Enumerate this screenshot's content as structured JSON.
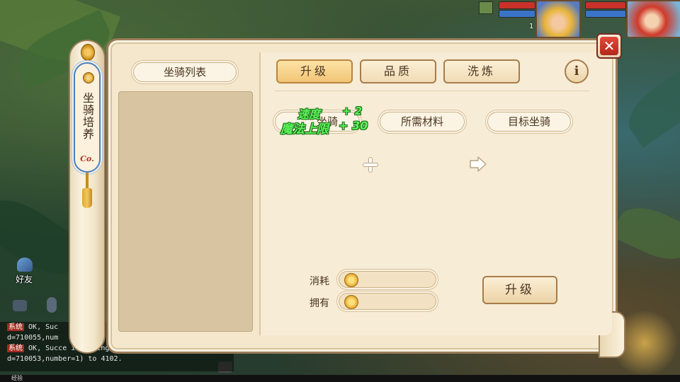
{
  "side_tab": {
    "label": "坐骑培养",
    "logo": "Co."
  },
  "mount_list": {
    "title": "坐骑列表"
  },
  "tabs": [
    {
      "label": "升级",
      "active": true
    },
    {
      "label": "品质",
      "active": false
    },
    {
      "label": "洗炼",
      "active": false
    }
  ],
  "info_label": "i",
  "sections": {
    "current_mount": "坐骑",
    "materials": "所需材料",
    "target_mount": "目标坐骑"
  },
  "floating_stats": [
    {
      "name": "速度",
      "value": "+ 2"
    },
    {
      "name": "魔法上限",
      "value": "+ 30"
    }
  ],
  "cost": {
    "label": "消耗",
    "value": ""
  },
  "owned": {
    "label": "拥有",
    "value": ""
  },
  "upgrade_button": "升级",
  "close_label": "✕",
  "hud": {
    "friends_label": "好友",
    "level_a": "1"
  },
  "chat": {
    "lines": [
      {
        "tag": "系统",
        "text": "OK, Suc"
      },
      {
        "tag": "",
        "text": "d=710055,num"
      },
      {
        "tag": "系统",
        "text": "OK, Succe      in adding 法宝合成符(i"
      },
      {
        "tag": "",
        "text": "d=710053,number=1) to 4102."
      }
    ]
  },
  "exp_label": "经验",
  "colors": {
    "accent_green": "#5cf25a",
    "close_red": "#e24a3a",
    "tab_active": "#f2c576",
    "panel_bg": "#f4e7cc"
  }
}
